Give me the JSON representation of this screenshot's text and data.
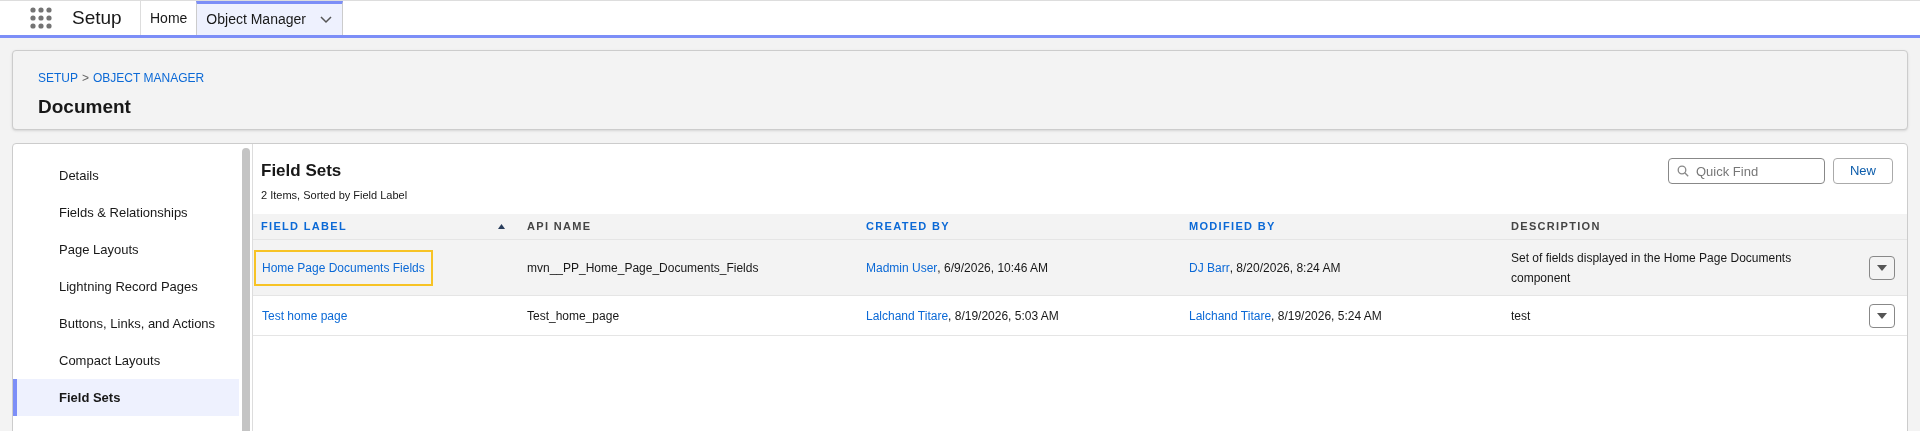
{
  "app": {
    "title": "Setup"
  },
  "nav_tabs": [
    {
      "label": "Home",
      "selected": false,
      "has_menu": false
    },
    {
      "label": "Object Manager",
      "selected": true,
      "has_menu": true
    }
  ],
  "header": {
    "breadcrumbs": [
      "SETUP",
      ">",
      "OBJECT MANAGER"
    ],
    "title": "Document"
  },
  "sidebar": {
    "items": [
      {
        "label": "Details",
        "selected": false
      },
      {
        "label": "Fields & Relationships",
        "selected": false
      },
      {
        "label": "Page Layouts",
        "selected": false
      },
      {
        "label": "Lightning Record Pages",
        "selected": false
      },
      {
        "label": "Buttons, Links, and Actions",
        "selected": false
      },
      {
        "label": "Compact Layouts",
        "selected": false
      },
      {
        "label": "Field Sets",
        "selected": true
      }
    ]
  },
  "content": {
    "title": "Field Sets",
    "subtitle": "2 Items, Sorted by Field Label",
    "search": {
      "placeholder": "Quick Find"
    },
    "new_button": "New",
    "table": {
      "columns": [
        {
          "label": "FIELD LABEL",
          "sortable": true,
          "sorted": true
        },
        {
          "label": "API NAME",
          "sortable": false,
          "sorted": false
        },
        {
          "label": "CREATED BY",
          "sortable": true,
          "sorted": false
        },
        {
          "label": "MODIFIED BY",
          "sortable": true,
          "sorted": false
        },
        {
          "label": "DESCRIPTION",
          "sortable": false,
          "sorted": false
        }
      ],
      "rows": [
        {
          "selected": true,
          "outlined": true,
          "field_label": "Home Page Documents Fields",
          "api_name": "mvn__PP_Home_Page_Documents_Fields",
          "created_by": {
            "user": "Madmin User",
            "date": ", 6/9/2026, 10:46 AM"
          },
          "modified_by": {
            "user": "DJ Barr",
            "date": ", 8/20/2026, 8:24 AM"
          },
          "description": "Set of fields displayed in the Home Page Documents component"
        },
        {
          "selected": false,
          "outlined": false,
          "field_label": "Test home page",
          "api_name": "Test_home_page",
          "created_by": {
            "user": "Lalchand Titare",
            "date": ", 8/19/2026, 5:03 AM"
          },
          "modified_by": {
            "user": "Lalchand Titare",
            "date": ", 8/19/2026, 5:24 AM"
          },
          "description": "test"
        }
      ]
    }
  }
}
